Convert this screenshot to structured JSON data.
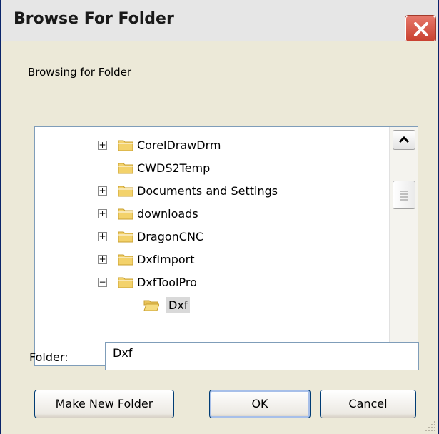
{
  "window": {
    "title": "Browse For Folder",
    "close_icon": "close-icon"
  },
  "dialog": {
    "prompt": "Browsing for Folder",
    "folder_label": "Folder:",
    "folder_value": "Dxf"
  },
  "tree": {
    "items": [
      {
        "label": "CorelDrawDrm",
        "expander": "+"
      },
      {
        "label": "CWDS2Temp",
        "expander": ""
      },
      {
        "label": "Documents and Settings",
        "expander": "+"
      },
      {
        "label": "downloads",
        "expander": "+"
      },
      {
        "label": "DragonCNC",
        "expander": "+"
      },
      {
        "label": "DxfImport",
        "expander": "+"
      },
      {
        "label": "DxfToolPro",
        "expander": "−"
      },
      {
        "label": "Dxf",
        "expander": "",
        "selected": true
      }
    ]
  },
  "buttons": {
    "make_new_folder": "Make New Folder",
    "ok": "OK",
    "cancel": "Cancel"
  },
  "colors": {
    "close_red": "#d94a3a",
    "folder_yellow": "#f3d26b",
    "selection_gray": "#d9d9d9"
  }
}
